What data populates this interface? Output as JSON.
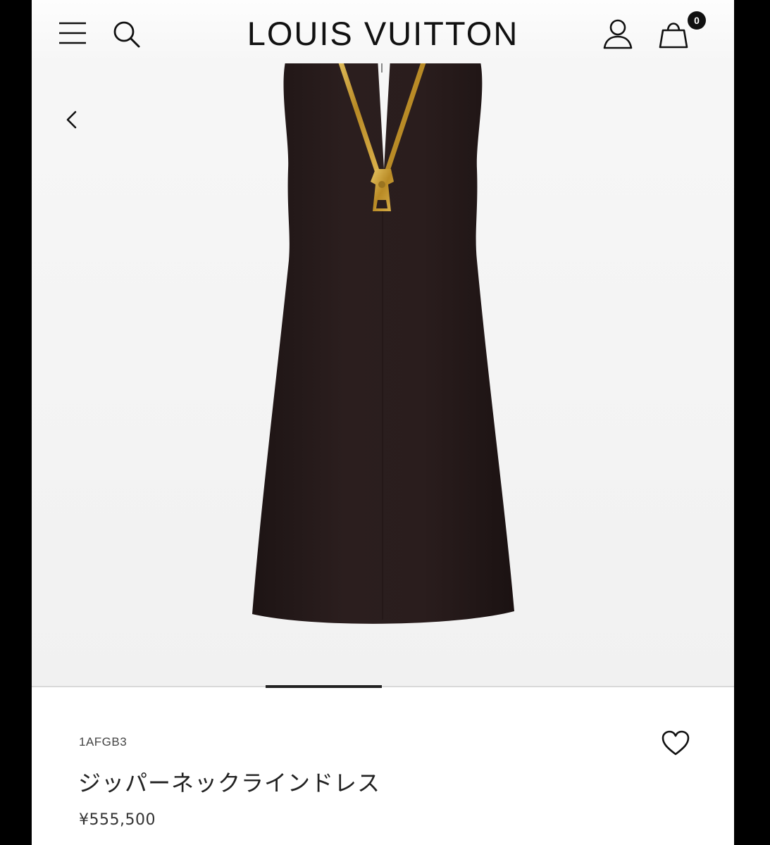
{
  "header": {
    "logo": "LOUIS VUITTON",
    "cart_count": "0",
    "icons": [
      "menu-icon",
      "search-icon",
      "account-icon",
      "shopping-bag-icon"
    ]
  },
  "gallery": {
    "back_icon": "chevron-left-icon",
    "image_subject": "black sleeveless dress with gold zipper neckline",
    "progress": {
      "current": 3,
      "total": 6,
      "position_fraction": 0.33
    }
  },
  "product": {
    "sku": "1AFGB3",
    "name": "ジッパーネックラインドレス",
    "price": "¥555,500",
    "wishlist_icon": "heart-icon"
  },
  "colors": {
    "text": "#111111",
    "dress": "#2a1d1d",
    "zipper": "#c9a23a"
  }
}
